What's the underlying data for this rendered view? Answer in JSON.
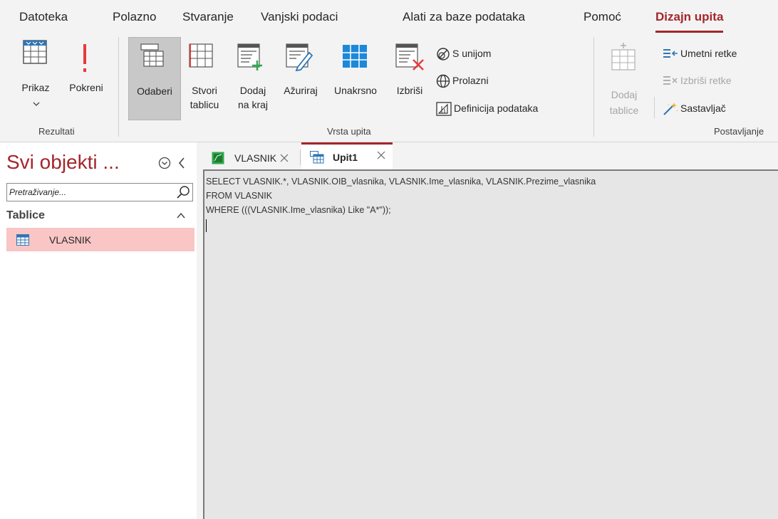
{
  "ribbon_tabs": [
    {
      "label": "Datoteka",
      "active": false
    },
    {
      "label": "Polazno",
      "active": false
    },
    {
      "label": "Stvaranje",
      "active": false
    },
    {
      "label": "Vanjski podaci",
      "active": false
    },
    {
      "label": "Alati za baze podataka",
      "active": false
    },
    {
      "label": "Pomoć",
      "active": false
    },
    {
      "label": "Dizajn upita",
      "active": true
    }
  ],
  "ribbon": {
    "results": {
      "view_label": "Prikaz",
      "view_icon": "datasheet-view-icon",
      "run_label": "Pokreni",
      "run_icon": "exclamation-run-icon",
      "group_label": "Rezultati"
    },
    "query_type": {
      "select_label": "Odaberi",
      "make_table_line1": "Stvori",
      "make_table_line2": "tablicu",
      "append_line1": "Dodaj",
      "append_line2": "na kraj",
      "update_label": "Ažuriraj",
      "crosstab_label": "Unakrsno",
      "delete_label": "Izbriši",
      "union_label": "S unijom",
      "passthrough_label": "Prolazni",
      "data_definition_label": "Definicija podataka",
      "group_label": "Vrsta upita"
    },
    "query_setup": {
      "add_tables_line1": "Dodaj",
      "add_tables_line2": "tablice",
      "insert_rows_label": "Umetni retke",
      "delete_rows_label": "Izbriši retke",
      "builder_label": "Sastavljač",
      "group_label": "Postavljanje"
    }
  },
  "nav_pane": {
    "title": "Svi objekti ...",
    "search_placeholder": "Pretraživanje...",
    "section_label": "Tablice",
    "items": [
      {
        "label": "VLASNIK",
        "icon": "table-icon",
        "selected": true
      }
    ]
  },
  "doc_tabs": [
    {
      "label": "VLASNIK",
      "icon": "table-datasheet-icon",
      "active": false
    },
    {
      "label": "Upit1",
      "icon": "query-icon",
      "active": true
    }
  ],
  "sql_editor": {
    "lines": [
      "SELECT VLASNIK.*, VLASNIK.OIB_vlasnika, VLASNIK.Ime_vlasnika, VLASNIK.Prezime_vlasnika",
      "FROM VLASNIK",
      "WHERE (((VLASNIK.Ime_vlasnika) Like \"A*\"));"
    ]
  },
  "colors": {
    "accent": "#a4262c",
    "selected_item_bg": "#f9c5c5",
    "editor_bg": "#e6e6e6"
  }
}
